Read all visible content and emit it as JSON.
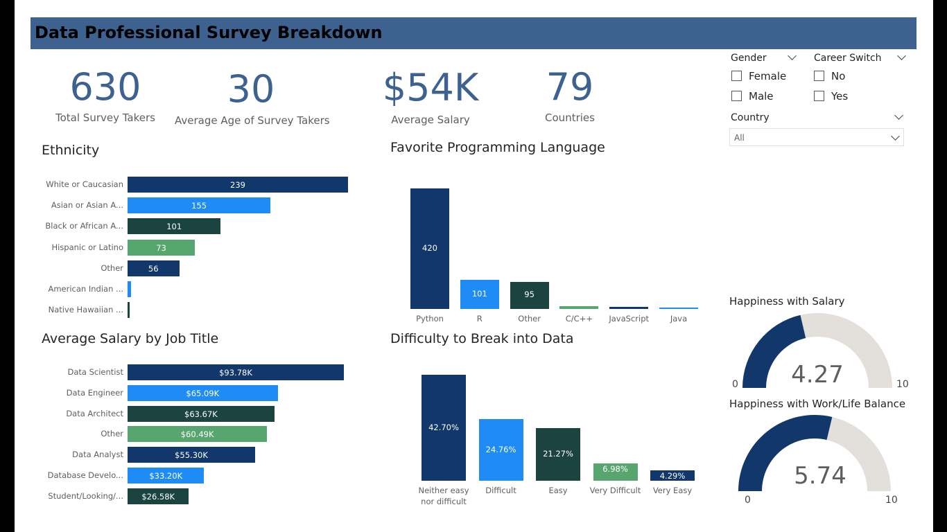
{
  "header": {
    "title": "Data Professional Survey Breakdown",
    "bg": "#3e6290"
  },
  "kpis": [
    {
      "value": "630",
      "label": "Total Survey Takers"
    },
    {
      "value": "30",
      "label": "Average Age of Survey Takers"
    },
    {
      "value": "$54K",
      "label": "Average Salary"
    },
    {
      "value": "79",
      "label": "Countries"
    }
  ],
  "slicers": {
    "gender": {
      "label": "Gender",
      "options": [
        "Female",
        "Male"
      ]
    },
    "career_switch": {
      "label": "Career Switch",
      "options": [
        "No",
        "Yes"
      ]
    },
    "country": {
      "label": "Country",
      "selected": "All"
    }
  },
  "colors": {
    "navy": "#12376b",
    "blue": "#1f8cf5",
    "darkgreen": "#1b4340",
    "green": "#57a56f",
    "gauge_bg": "#e3dfda"
  },
  "charts": {
    "ethnicity": {
      "title": "Ethnicity",
      "type": "bar",
      "xmax": 239,
      "categories": [
        "White or Caucasian",
        "Asian or Asian A...",
        "Black or African A...",
        "Hispanic or Latino",
        "Other",
        "American Indian ...",
        "Native Hawaiian ..."
      ],
      "values": [
        239,
        155,
        101,
        73,
        56,
        4,
        2
      ],
      "labels": [
        "239",
        "155",
        "101",
        "73",
        "56",
        "",
        ""
      ],
      "colors": [
        "#12376b",
        "#1f8cf5",
        "#1b4340",
        "#57a56f",
        "#12376b",
        "#1f8cf5",
        "#1b4340"
      ]
    },
    "language": {
      "title": "Favorite Programming Language",
      "type": "bar",
      "ymax": 420,
      "categories": [
        "Python",
        "R",
        "Other",
        "C/C++",
        "JavaScript",
        "Java"
      ],
      "values": [
        420,
        101,
        95,
        9,
        7,
        2
      ],
      "labels": [
        "420",
        "101",
        "95",
        "",
        "",
        ""
      ],
      "colors": [
        "#12376b",
        "#1f8cf5",
        "#1b4340",
        "#57a56f",
        "#12376b",
        "#1f8cf5"
      ]
    },
    "salary": {
      "title": "Average Salary by Job Title",
      "type": "bar",
      "xmax": 93.78,
      "categories": [
        "Data Scientist",
        "Data Engineer",
        "Data Architect",
        "Other",
        "Data Analyst",
        "Database Develo...",
        "Student/Looking/..."
      ],
      "values": [
        93.78,
        65.09,
        63.67,
        60.49,
        55.3,
        33.2,
        26.58
      ],
      "labels": [
        "$93.78K",
        "$65.09K",
        "$63.67K",
        "$60.49K",
        "$55.30K",
        "$33.20K",
        "$26.58K"
      ],
      "colors": [
        "#12376b",
        "#1f8cf5",
        "#1b4340",
        "#57a56f",
        "#12376b",
        "#1f8cf5",
        "#1b4340"
      ]
    },
    "difficulty": {
      "title": "Difficulty to Break into Data",
      "type": "bar",
      "ymax": 42.7,
      "categories": [
        "Neither easy nor difficult",
        "Difficult",
        "Easy",
        "Very Difficult",
        "Very Easy"
      ],
      "values": [
        42.7,
        24.76,
        21.27,
        6.98,
        4.29
      ],
      "labels": [
        "42.70%",
        "24.76%",
        "21.27%",
        "6.98%",
        "4.29%"
      ],
      "colors": [
        "#12376b",
        "#1f8cf5",
        "#1b4340",
        "#57a56f",
        "#12376b"
      ]
    }
  },
  "gauges": [
    {
      "title": "Happiness with Salary",
      "value": 4.27,
      "value_text": "4.27",
      "min": 0,
      "max": 10,
      "min_text": "0",
      "max_text": "10"
    },
    {
      "title": "Happiness with Work/Life Balance",
      "value": 5.74,
      "value_text": "5.74",
      "min": 0,
      "max": 10,
      "min_text": "0",
      "max_text": "10"
    }
  ]
}
